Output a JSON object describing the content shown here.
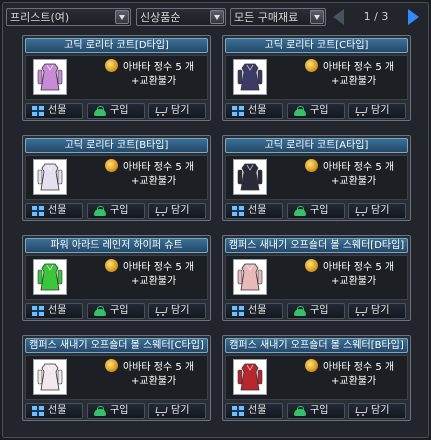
{
  "filters": {
    "job": "프리스트(여)",
    "category": "신상품순",
    "currency": "모든 구매재료"
  },
  "pager": {
    "text": "1 / 3"
  },
  "labels": {
    "gift": "선물",
    "buy": "구입",
    "cart": "담기"
  },
  "items": [
    {
      "title": "고딕 로리타 코트[D타입]",
      "price": "아바타 정수 5 개",
      "trade": "+교환불가",
      "color": "#c98ad6",
      "icon": "dress-icon"
    },
    {
      "title": "고딕 로리타 코트[C타입]",
      "price": "아바타 정수 5 개",
      "trade": "+교환불가",
      "color": "#3c3a66",
      "icon": "dress-icon"
    },
    {
      "title": "고딕 로리타 코트[B타입]",
      "price": "아바타 정수 5 개",
      "trade": "+교환불가",
      "color": "#e4e0ef",
      "icon": "dress-icon"
    },
    {
      "title": "고딕 로리타 코트[A타입]",
      "price": "아바타 정수 5 개",
      "trade": "+교환불가",
      "color": "#2a2a3a",
      "icon": "dress-icon"
    },
    {
      "title": "파워 아라드 레인저 하이퍼 슈트",
      "price": "아바타 정수 5 개",
      "trade": "+교환불가",
      "color": "#3ac83a",
      "icon": "suit-icon"
    },
    {
      "title": "캠퍼스 새내기 오프숄더 볼 스웨터[D타입]",
      "price": "아바타 정수 5 개",
      "trade": "+교환불가",
      "color": "#e9b8b8",
      "icon": "sweater-icon"
    },
    {
      "title": "캠퍼스 새내기 오프숄더 볼 스웨터[C타입]",
      "price": "아바타 정수 5 개",
      "trade": "+교환불가",
      "color": "#f0e8ec",
      "icon": "sweater-icon"
    },
    {
      "title": "캠퍼스 새내기 오프숄더 볼 스웨터[B타입]",
      "price": "아바타 정수 5 개",
      "trade": "+교환불가",
      "color": "#b8262e",
      "icon": "sweater-icon"
    }
  ]
}
